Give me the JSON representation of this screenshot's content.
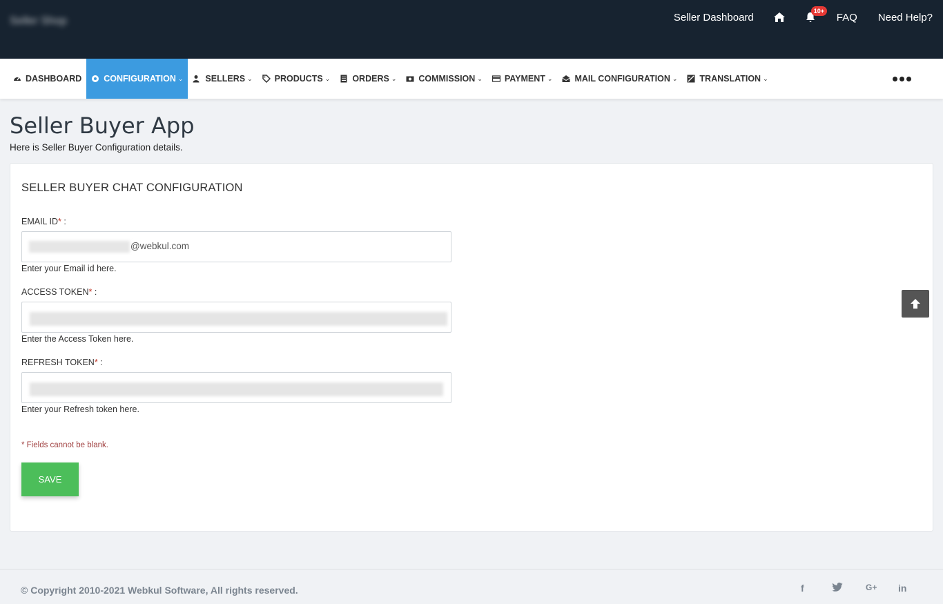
{
  "header": {
    "store_name": "Seller Shop",
    "links": {
      "dashboard": "Seller Dashboard",
      "faq": "FAQ",
      "help": "Need Help?"
    },
    "notification_count": "10+"
  },
  "nav": {
    "items": [
      {
        "label": "DASHBOARD",
        "icon": "dashboard-icon",
        "dropdown": false
      },
      {
        "label": "CONFIGURATION",
        "icon": "gear-icon",
        "dropdown": true,
        "active": true
      },
      {
        "label": "SELLERS",
        "icon": "users-icon",
        "dropdown": true
      },
      {
        "label": "PRODUCTS",
        "icon": "tag-icon",
        "dropdown": true
      },
      {
        "label": "ORDERS",
        "icon": "list-icon",
        "dropdown": true
      },
      {
        "label": "COMMISSION",
        "icon": "money-icon",
        "dropdown": true
      },
      {
        "label": "PAYMENT",
        "icon": "credit-card-icon",
        "dropdown": true
      },
      {
        "label": "MAIL CONFIGURATION",
        "icon": "envelope-icon",
        "dropdown": true
      },
      {
        "label": "TRANSLATION",
        "icon": "translate-icon",
        "dropdown": true
      }
    ]
  },
  "page": {
    "title": "Seller Buyer App",
    "subtitle": "Here is Seller Buyer Configuration details."
  },
  "form": {
    "section_title": "SELLER BUYER CHAT CONFIGURATION",
    "email": {
      "label": "EMAIL ID",
      "required_mark": "*",
      "label_suffix": " :",
      "value_suffix": "@webkul.com",
      "help": "Enter your Email id here."
    },
    "access_token": {
      "label": "ACCESS TOKEN",
      "required_mark": "*",
      "label_suffix": " :",
      "help": "Enter the Access Token here."
    },
    "refresh_token": {
      "label": "REFRESH TOKEN",
      "required_mark": "*",
      "label_suffix": " :",
      "help": "Enter your Refresh token here."
    },
    "note": "* Fields cannot be blank.",
    "save_label": "SAVE"
  },
  "footer": {
    "copyright": "© Copyright 2010-2021 Webkul Software, All rights reserved.",
    "social": [
      "f",
      "twitter",
      "G+",
      "in"
    ]
  },
  "colors": {
    "header_bg": "#172330",
    "active_nav": "#3c9be0",
    "save_button": "#4cbe5a",
    "badge": "#e53935"
  }
}
